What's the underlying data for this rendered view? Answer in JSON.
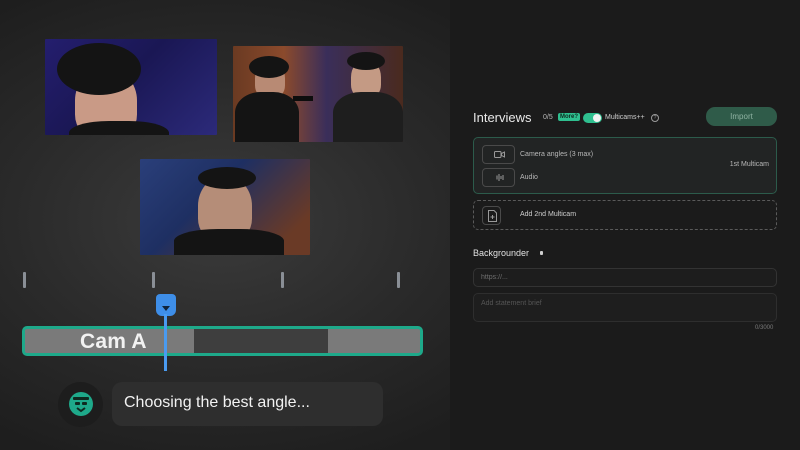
{
  "timeline": {
    "track_label": "Cam A",
    "tick_count": 4
  },
  "assistant": {
    "status_text": "Choosing the best angle..."
  },
  "panel": {
    "title": "Interviews",
    "count": "0/5",
    "more_badge": "More?",
    "multicams_toggle_on": true,
    "multicams_label": "Multicams++",
    "help_glyph": "?",
    "import_label": "Import",
    "multicam_card": {
      "camera_label": "Camera angles (3 max)",
      "audio_label": "Audio",
      "tag": "1st Multicam"
    },
    "add_label": "Add 2nd Multicam",
    "backgrounder": {
      "title": "Backgrounder",
      "url_placeholder": "https://...",
      "statement_placeholder": "Add statement brief",
      "char_count": "0/3000"
    }
  },
  "colors": {
    "accent_green": "#2fbf8f",
    "track_border": "#1ea98a",
    "playhead_blue": "#3e8ee8"
  },
  "icons": {
    "camera": "video-camera-icon",
    "audio": "waveform-icon",
    "add": "add-file-icon",
    "assistant": "assistant-avatar-icon",
    "help": "help-circle-icon"
  }
}
